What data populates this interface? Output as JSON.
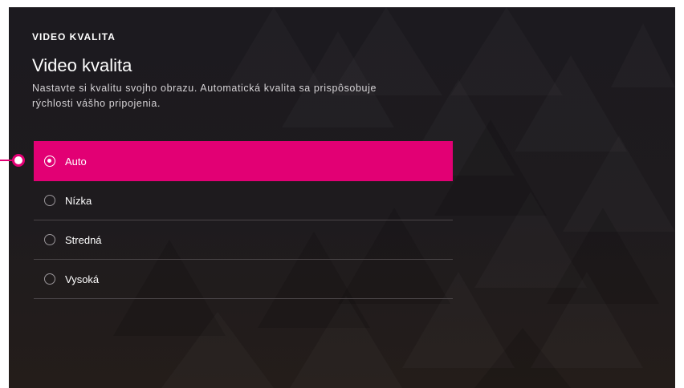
{
  "header": {
    "section_label": "VIDEO KVALITA",
    "title": "Video kvalita",
    "description": "Nastavte si kvalitu svojho obrazu. Automatická kvalita sa prispôsobuje rýchlosti vášho pripojenia."
  },
  "options": [
    {
      "label": "Auto",
      "selected": true
    },
    {
      "label": "Nízka",
      "selected": false
    },
    {
      "label": "Stredná",
      "selected": false
    },
    {
      "label": "Vysoká",
      "selected": false
    }
  ],
  "colors": {
    "accent": "#e20074",
    "background": "#1c1a1f",
    "text": "#ffffff"
  },
  "icons": {
    "focus_indicator": "focus-pointer-icon",
    "radio_selected": "radio-checked-icon",
    "radio_unselected": "radio-unchecked-icon"
  }
}
